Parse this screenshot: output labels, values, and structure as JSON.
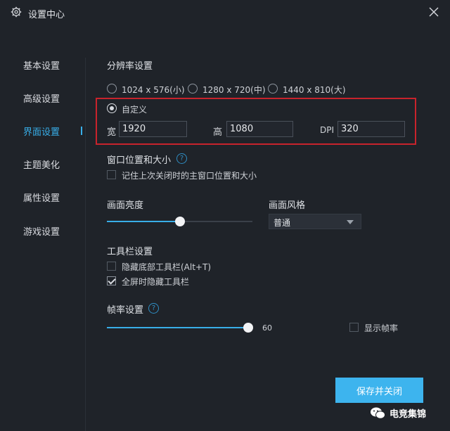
{
  "window": {
    "title": "设置中心"
  },
  "sidebar": {
    "items": [
      {
        "label": "基本设置"
      },
      {
        "label": "高级设置"
      },
      {
        "label": "界面设置"
      },
      {
        "label": "主题美化"
      },
      {
        "label": "属性设置"
      },
      {
        "label": "游戏设置"
      }
    ],
    "active_index": 2
  },
  "resolution": {
    "title": "分辨率设置",
    "options": [
      {
        "label": "1024 x 576(小)",
        "checked": false
      },
      {
        "label": "1280 x 720(中)",
        "checked": false
      },
      {
        "label": "1440 x 810(大)",
        "checked": false
      },
      {
        "label": "自定义",
        "checked": true
      }
    ],
    "width_label": "宽",
    "width_value": "1920",
    "height_label": "高",
    "height_value": "1080",
    "dpi_label": "DPI",
    "dpi_value": "320"
  },
  "window_position": {
    "title": "窗口位置和大小",
    "remember_label": "记住上次关闭时的主窗口位置和大小",
    "remember_checked": false
  },
  "brightness": {
    "title": "画面亮度",
    "level_percent": 50
  },
  "style": {
    "title": "画面风格",
    "selected": "普通"
  },
  "toolbar": {
    "title": "工具栏设置",
    "hide_bottom_label": "隐藏底部工具栏(Alt+T)",
    "hide_bottom_checked": false,
    "hide_fullscreen_label": "全屏时隐藏工具栏",
    "hide_fullscreen_checked": true
  },
  "framerate": {
    "title": "帧率设置",
    "value": "60",
    "max": 60,
    "show_label": "显示帧率",
    "show_checked": false
  },
  "save_button": {
    "label": "保存并关闭"
  },
  "watermark": {
    "text": "电竞集锦"
  },
  "colors": {
    "accent": "#38aee8",
    "highlight_box": "#c8232c",
    "background": "#1f2329"
  }
}
